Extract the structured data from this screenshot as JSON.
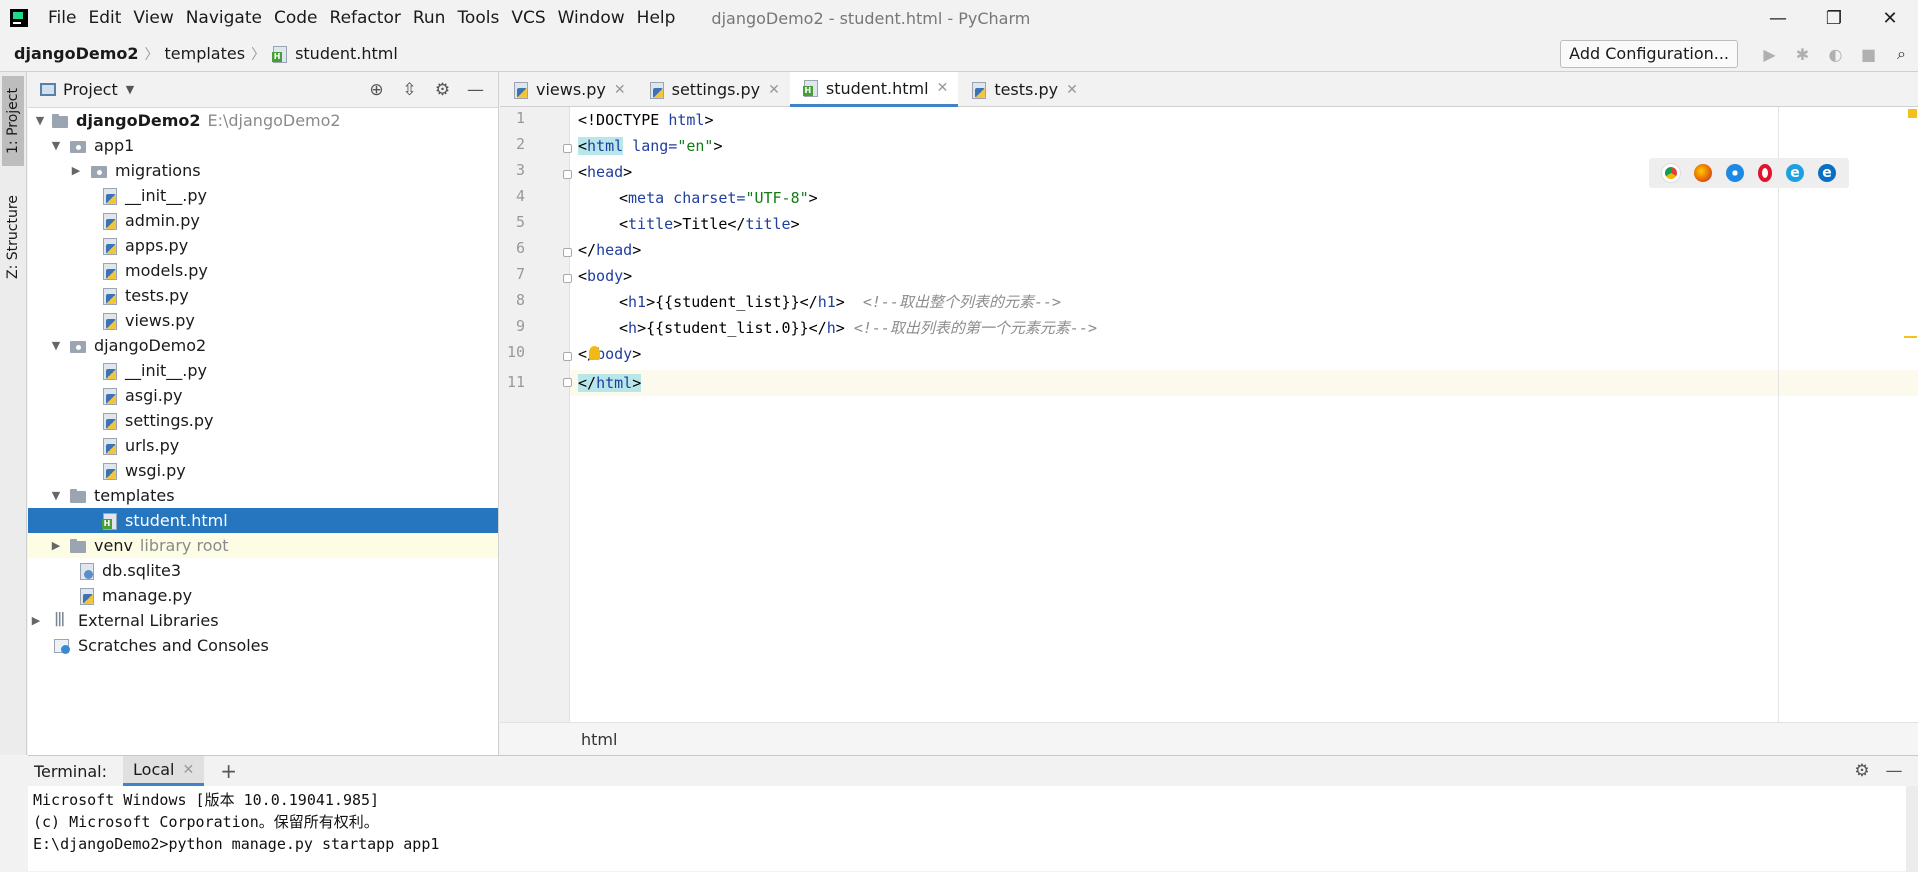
{
  "menu": [
    "File",
    "Edit",
    "View",
    "Navigate",
    "Code",
    "Refactor",
    "Run",
    "Tools",
    "VCS",
    "Window",
    "Help"
  ],
  "window_title": "djangoDemo2 - student.html - PyCharm",
  "window_controls": {
    "minimize": "—",
    "restore": "❐",
    "close": "✕"
  },
  "breadcrumb": {
    "root": "djangoDemo2",
    "folder": "templates",
    "file": "student.html"
  },
  "add_config": "Add Configuration...",
  "stripe": {
    "project": "1: Project",
    "structure": "Z: Structure"
  },
  "project_panel": {
    "title": "Project",
    "rows": [
      {
        "label": "djangoDemo2",
        "extra": "E:\\djangoDemo2"
      },
      {
        "label": "app1"
      },
      {
        "label": "migrations"
      },
      {
        "label": "__init__.py"
      },
      {
        "label": "admin.py"
      },
      {
        "label": "apps.py"
      },
      {
        "label": "models.py"
      },
      {
        "label": "tests.py"
      },
      {
        "label": "views.py"
      },
      {
        "label": "djangoDemo2"
      },
      {
        "label": "__init__.py"
      },
      {
        "label": "asgi.py"
      },
      {
        "label": "settings.py"
      },
      {
        "label": "urls.py"
      },
      {
        "label": "wsgi.py"
      },
      {
        "label": "templates"
      },
      {
        "label": "student.html"
      },
      {
        "label": "venv",
        "extra": "library root"
      },
      {
        "label": "db.sqlite3"
      },
      {
        "label": "manage.py"
      },
      {
        "label": "External Libraries"
      },
      {
        "label": "Scratches and Consoles"
      }
    ]
  },
  "tabs": [
    "views.py",
    "settings.py",
    "student.html",
    "tests.py"
  ],
  "line_numbers": [
    "1",
    "2",
    "3",
    "4",
    "5",
    "6",
    "7",
    "8",
    "9",
    "10",
    "11"
  ],
  "code": {
    "l1": {
      "a": "<!DOCTYPE ",
      "b": "html",
      "c": ">"
    },
    "l2": {
      "a": "<",
      "b": "html",
      "c": " lang=",
      "d": "\"en\"",
      "e": ">"
    },
    "l3": {
      "a": "<",
      "b": "head",
      "c": ">"
    },
    "l4": {
      "a": "<",
      "b": "meta",
      "c": " charset=",
      "d": "\"UTF-8\"",
      "e": ">"
    },
    "l5": {
      "a": "<",
      "b": "title",
      "c": ">Title</",
      "d": "title",
      "e": ">"
    },
    "l6": {
      "a": "</",
      "b": "head",
      "c": ">"
    },
    "l7": {
      "a": "<",
      "b": "body",
      "c": ">"
    },
    "l8": {
      "a": "<",
      "b": "h1",
      "c": ">{{student_list}}</",
      "d": "h1",
      "e": ">",
      "comment": "<!--取出整个列表的元素-->"
    },
    "l9": {
      "a": "<",
      "b": "h",
      "c": ">{{student_list.0}}</",
      "d": "h",
      "e": ">",
      "comment": "<!--取出列表的第一个元素元素-->"
    },
    "l10": {
      "a": "</",
      "b": "body",
      "c": ">"
    },
    "l11": {
      "a": "</",
      "b": "html",
      "c": ">"
    }
  },
  "editor_breadcrumb": "html",
  "terminal": {
    "label": "Terminal:",
    "tab": "Local",
    "lines": [
      "Microsoft Windows [版本 10.0.19041.985]",
      "(c) Microsoft Corporation。保留所有权利。",
      "E:\\djangoDemo2>python manage.py startapp app1"
    ]
  },
  "browser_icons": [
    "chrome-icon",
    "firefox-icon",
    "safari-icon",
    "opera-icon",
    "ie-icon",
    "edge-icon"
  ],
  "colors": {
    "selection": "#2675bf",
    "tag": "#1f3ea0",
    "string": "#147a14",
    "comment": "#8c8c8c",
    "active_tab_underline": "#4083c9"
  }
}
